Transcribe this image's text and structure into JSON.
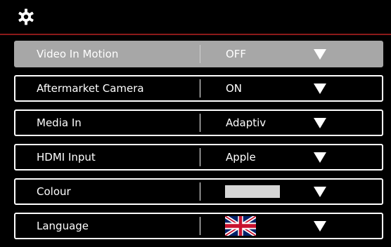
{
  "header": {
    "icon": "gear-icon",
    "accent_line_color": "#8b1a1a"
  },
  "settings": {
    "video_in_motion": {
      "label": "Video In Motion",
      "value": "OFF"
    },
    "aftermarket_camera": {
      "label": "Aftermarket Camera",
      "value": "ON"
    },
    "media_in": {
      "label": "Media In",
      "value": "Adaptiv"
    },
    "hdmi_input": {
      "label": "HDMI Input",
      "value": "Apple"
    },
    "colour": {
      "label": "Colour",
      "swatch_color": "#d6d6d6"
    },
    "language": {
      "label": "Language",
      "flag_icon": "uk-flag-icon"
    }
  },
  "colors": {
    "selected_row": "#a7a7a7",
    "background": "#000000",
    "text": "#ffffff"
  }
}
